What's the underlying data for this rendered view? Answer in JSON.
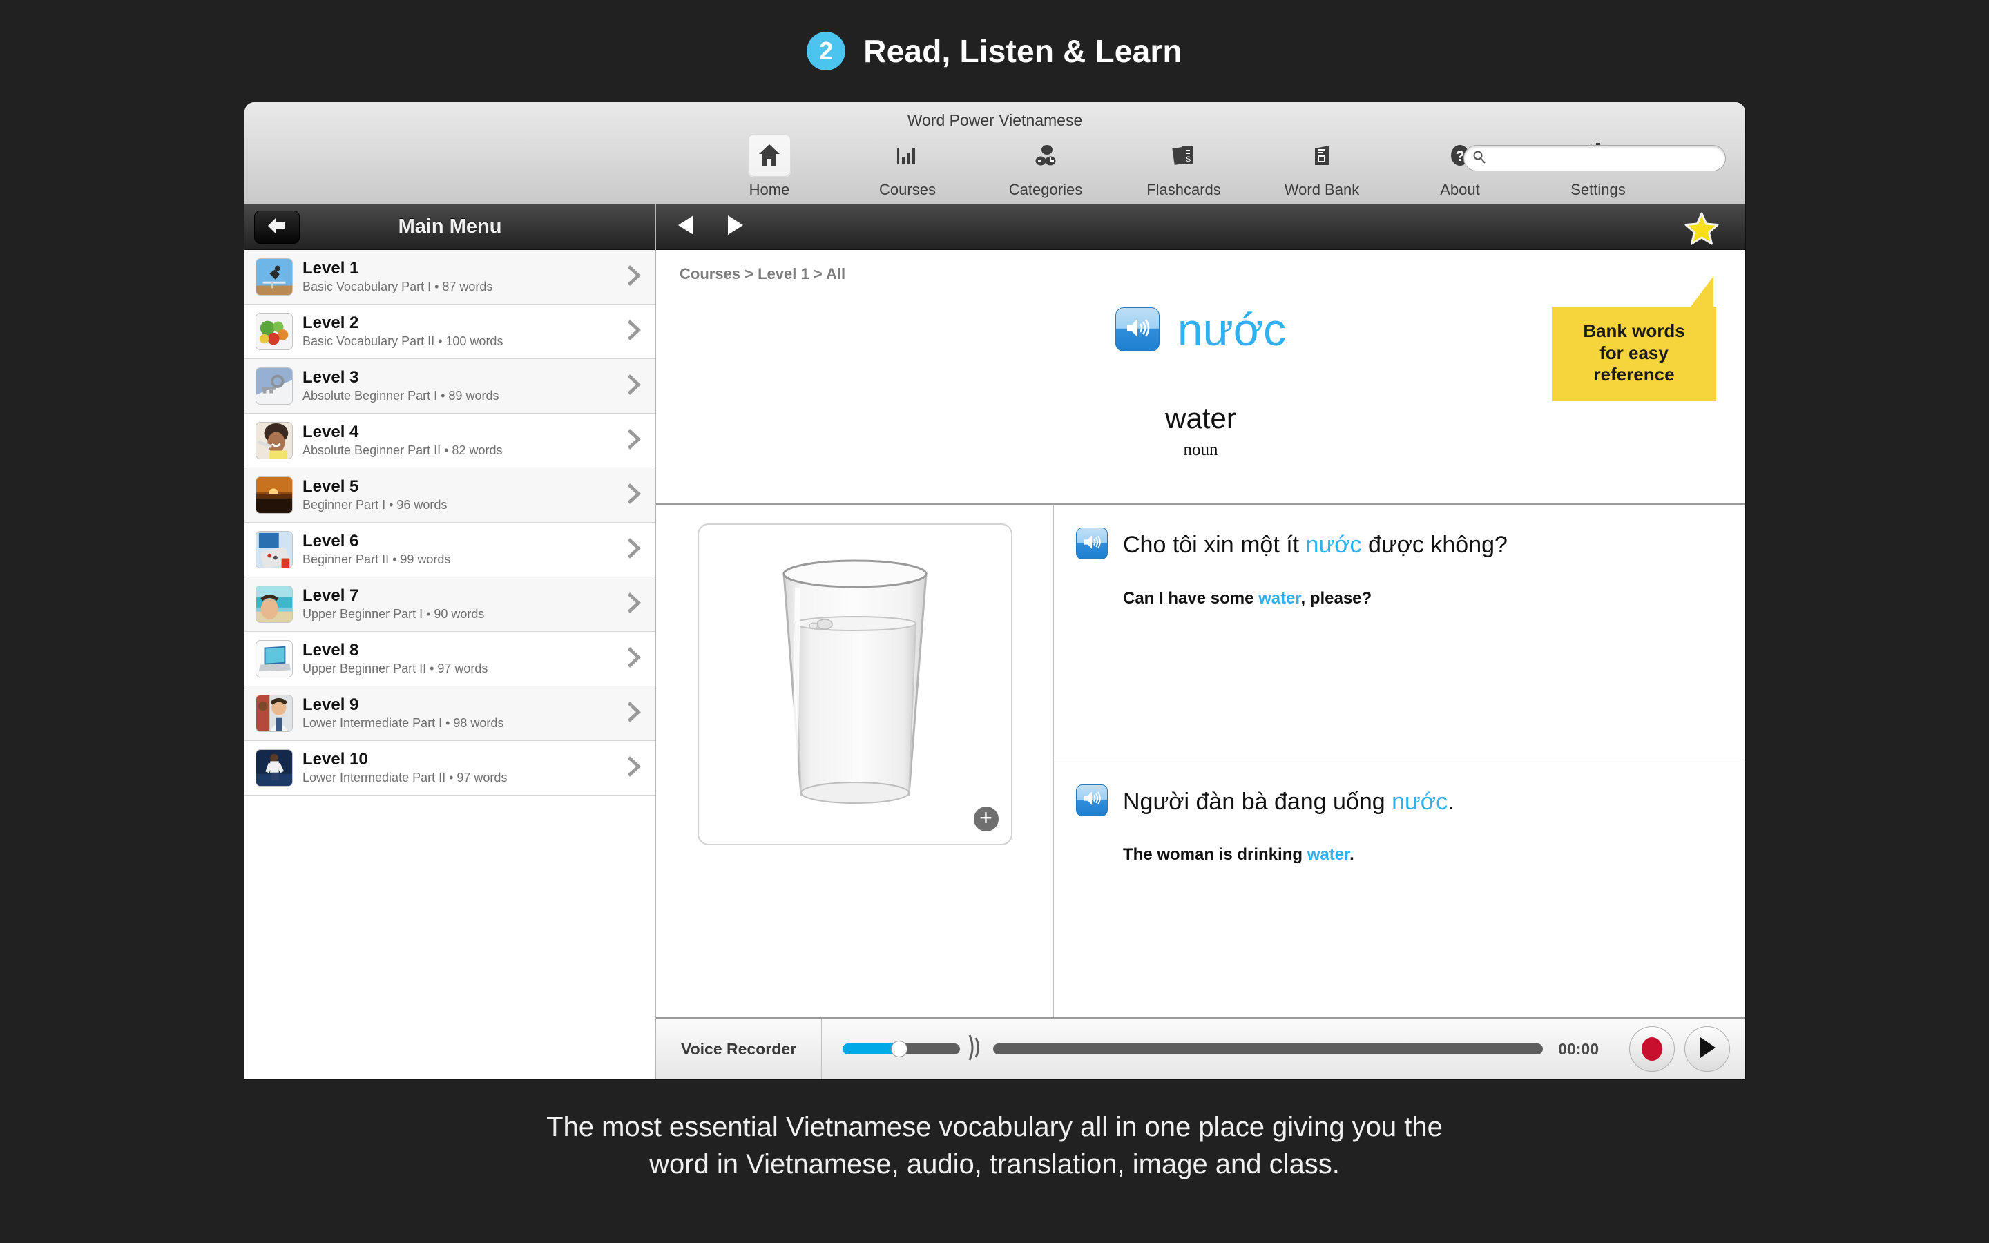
{
  "promo": {
    "step_number": "2",
    "title": "Read, Listen & Learn",
    "caption_line1": "The most essential Vietnamese vocabulary all in one place giving you the",
    "caption_line2": "word in Vietnamese, audio, translation, image and class.",
    "badge_color": "#4cc4f0"
  },
  "window": {
    "title": "Word Power Vietnamese"
  },
  "toolbar": {
    "items": [
      {
        "label": "Home",
        "icon": "home-icon",
        "active": true
      },
      {
        "label": "Courses",
        "icon": "bar-chart-icon",
        "active": false
      },
      {
        "label": "Categories",
        "icon": "categories-icon",
        "active": false
      },
      {
        "label": "Flashcards",
        "icon": "flashcards-icon",
        "active": false
      },
      {
        "label": "Word Bank",
        "icon": "word-bank-icon",
        "active": false
      },
      {
        "label": "About",
        "icon": "question-mark-icon",
        "active": false
      },
      {
        "label": "Settings",
        "icon": "gear-icon",
        "active": false
      }
    ],
    "search": {
      "value": "",
      "placeholder": ""
    }
  },
  "sidebar": {
    "title": "Main Menu",
    "back_icon": "back-arrow-icon",
    "levels": [
      {
        "name": "Level 1",
        "sub": "Basic Vocabulary Part I • 87 words",
        "thumb": "hurdler"
      },
      {
        "name": "Level 2",
        "sub": "Basic Vocabulary Part II • 100 words",
        "thumb": "vegetables"
      },
      {
        "name": "Level 3",
        "sub": "Absolute Beginner Part I • 89 words",
        "thumb": "keys"
      },
      {
        "name": "Level 4",
        "sub": "Absolute Beginner Part II • 82 words",
        "thumb": "toothbrush"
      },
      {
        "name": "Level 5",
        "sub": "Beginner Part I • 96 words",
        "thumb": "sunset"
      },
      {
        "name": "Level 6",
        "sub": "Beginner Part II • 99 words",
        "thumb": "remote"
      },
      {
        "name": "Level 7",
        "sub": "Upper Beginner Part I • 90 words",
        "thumb": "beach"
      },
      {
        "name": "Level 8",
        "sub": "Upper Beginner Part II • 97 words",
        "thumb": "laptop"
      },
      {
        "name": "Level 9",
        "sub": "Lower Intermediate Part I • 98 words",
        "thumb": "classroom"
      },
      {
        "name": "Level 10",
        "sub": "Lower Intermediate Part II • 97 words",
        "thumb": "runner"
      }
    ]
  },
  "content": {
    "breadcrumb": "Courses > Level 1 > All",
    "prev_icon": "previous-arrow-icon",
    "next_icon": "next-arrow-icon",
    "star_icon": "star-icon",
    "word": {
      "target": "nước",
      "translation": "water",
      "part_of_speech": "noun",
      "accent_color": "#31b0f0"
    },
    "callout": {
      "line1": "Bank words",
      "line2": "for easy",
      "line3": "reference",
      "bg_color": "#f6d53c"
    },
    "image": {
      "alt": "glass-of-water",
      "zoom_label": "+"
    },
    "sentences": [
      {
        "vn_pre": "Cho tôi xin một ít ",
        "vn_hl": "nước",
        "vn_post": " được không?",
        "en_pre": "Can I have some ",
        "en_hl": "water",
        "en_post": ", please?"
      },
      {
        "vn_pre": "Người đàn bà đang uống ",
        "vn_hl": "nước",
        "vn_post": ".",
        "en_pre": "The woman is drinking ",
        "en_hl": "water",
        "en_post": "."
      }
    ]
  },
  "recorder": {
    "label": "Voice Recorder",
    "time": "00:00",
    "volume_percent": 48,
    "progress_percent": 0,
    "record_icon": "record-icon",
    "play_icon": "play-icon"
  }
}
